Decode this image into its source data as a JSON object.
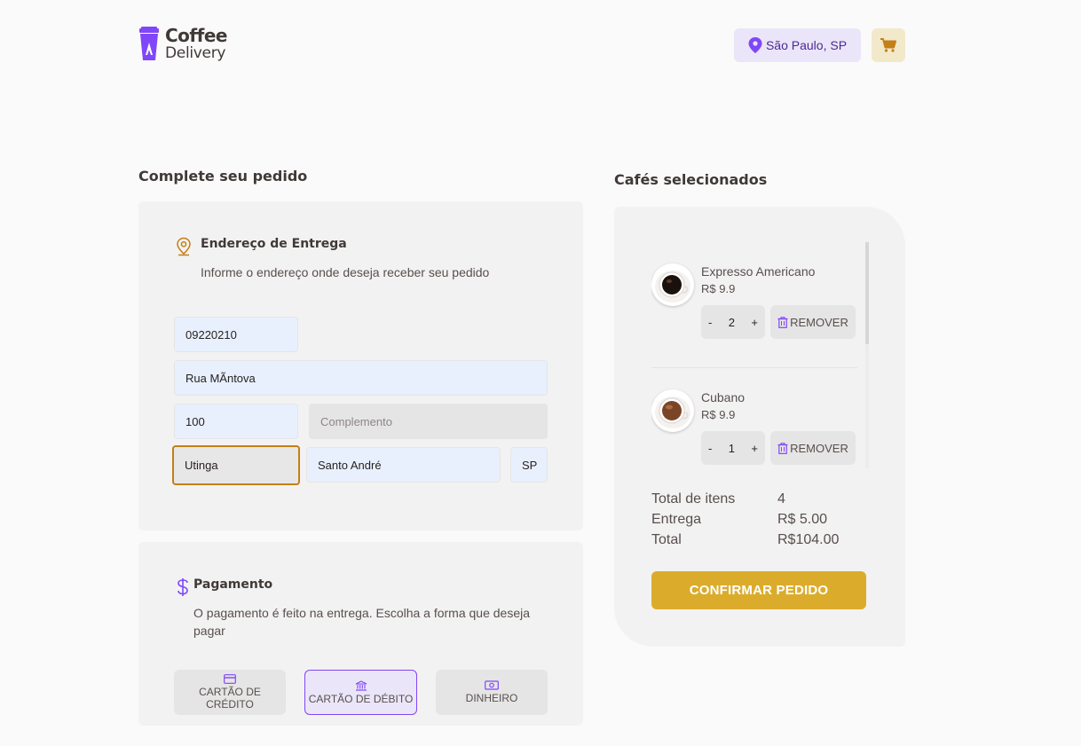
{
  "header": {
    "logo_line1": "Coffee",
    "logo_line2": "Delivery",
    "location": "São Paulo, SP"
  },
  "order": {
    "title": "Complete seu pedido",
    "address": {
      "heading": "Endereço de Entrega",
      "subtitle": "Informe o endereço onde deseja receber seu pedido",
      "cep": "09220210",
      "street": "Rua MÃntova",
      "number": "100",
      "complement_placeholder": "Complemento",
      "neighborhood": "Utinga",
      "city": "Santo André",
      "uf": "SP"
    },
    "payment": {
      "heading": "Pagamento",
      "subtitle": "O pagamento é feito na entrega. Escolha a forma que deseja pagar",
      "options": [
        {
          "label": "CARTÃO DE CRÉDITO",
          "selected": false
        },
        {
          "label": "CARTÃO DE DÉBITO",
          "selected": true
        },
        {
          "label": "DINHEIRO",
          "selected": false
        }
      ]
    }
  },
  "cart": {
    "title": "Cafés selecionados",
    "items": [
      {
        "name": "Expresso Americano",
        "price": "R$ 9.9",
        "qty": "2",
        "remove": "REMOVER"
      },
      {
        "name": "Cubano",
        "price": "R$ 9.9",
        "qty": "1",
        "remove": "REMOVER"
      }
    ],
    "stepper_minus": "-",
    "stepper_plus": "+",
    "totals": {
      "items_label": "Total de itens",
      "items_value": "4",
      "delivery_label": "Entrega",
      "delivery_value": "R$ 5.00",
      "total_label": "Total",
      "total_value": "R$104.00"
    },
    "confirm_label": "CONFIRMAR PEDIDO"
  },
  "colors": {
    "purple": "#8047f8",
    "purple_dark": "#4b2995",
    "yellow": "#dbac2c",
    "yellow_dark": "#c47f17"
  }
}
